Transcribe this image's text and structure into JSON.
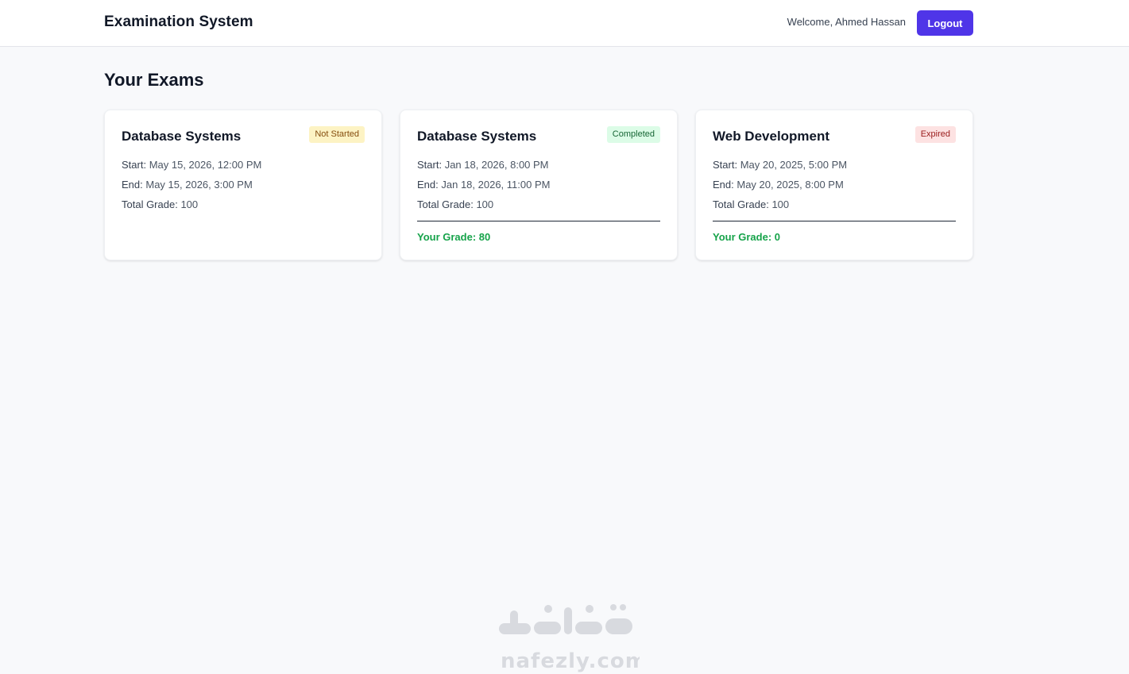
{
  "header": {
    "app_title": "Examination System",
    "welcome_text": "Welcome, Ahmed Hassan",
    "logout_label": "Logout"
  },
  "main": {
    "page_title": "Your Exams",
    "exams": [
      {
        "title": "Database Systems",
        "status": "Not Started",
        "status_color": "yellow",
        "start_label": "Start:",
        "start": "May 15, 2026, 12:00 PM",
        "end_label": "End:",
        "end": "May 15, 2026, 3:00 PM",
        "total_label": "Total Grade:",
        "total": "100",
        "your_grade": ""
      },
      {
        "title": "Database Systems",
        "status": "Completed",
        "status_color": "green",
        "start_label": "Start:",
        "start": "Jan 18, 2026, 8:00 PM",
        "end_label": "End:",
        "end": "Jan 18, 2026, 11:00 PM",
        "total_label": "Total Grade:",
        "total": "100",
        "your_grade": "Your Grade: 80"
      },
      {
        "title": "Web Development",
        "status": "Expired",
        "status_color": "red",
        "start_label": "Start:",
        "start": "May 20, 2025, 5:00 PM",
        "end_label": "End:",
        "end": "May 20, 2025, 8:00 PM",
        "total_label": "Total Grade:",
        "total": "100",
        "your_grade": "Your Grade: 0"
      }
    ]
  },
  "watermark": {
    "arabic": "نفذلي",
    "latin": "nafezly.com"
  },
  "colors": {
    "accent": "#4f35e8",
    "grade": "#16a34a",
    "background": "#f8f9fb"
  }
}
